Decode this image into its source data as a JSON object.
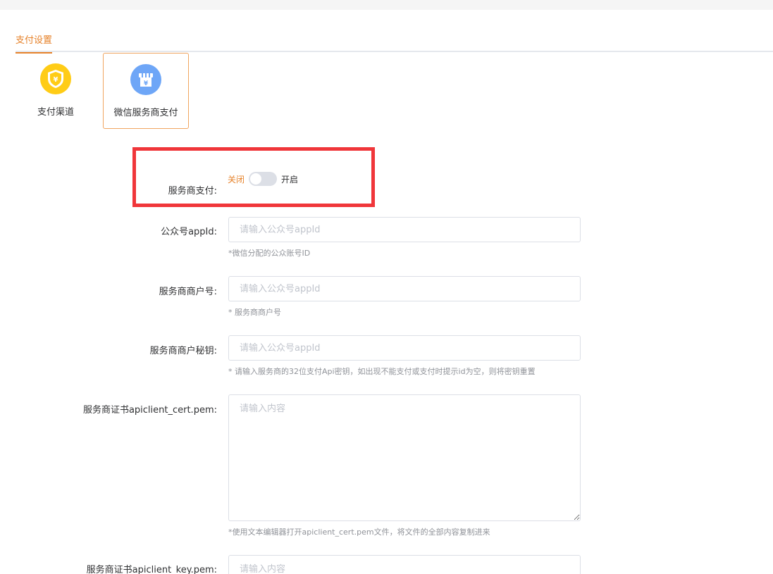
{
  "tabs": {
    "active": "支付设置"
  },
  "channels": [
    {
      "label": "支付渠道",
      "icon": "shield-yuan-icon",
      "color": "#ffcc16"
    },
    {
      "label": "微信服务商支付",
      "icon": "shop-yuan-icon",
      "color": "#6ea6f7",
      "selected": true
    }
  ],
  "form": {
    "service_pay": {
      "label": "服务商支付:",
      "off": "关闭",
      "on": "开启",
      "value": false
    },
    "appid": {
      "label": "公众号appId:",
      "placeholder": "请输入公众号appId",
      "hint": "*微信分配的公众账号ID"
    },
    "mch_id": {
      "label": "服务商商户号:",
      "placeholder": "请输入公众号appId",
      "hint": "* 服务商商户号"
    },
    "mch_key": {
      "label": "服务商商户秘钥:",
      "placeholder": "请输入公众号appId",
      "hint": "* 请输入服务商的32位支付Api密钥，如出现不能支付或支付时提示id为空，则将密钥重置"
    },
    "cert": {
      "label": "服务商证书apiclient_cert.pem:",
      "placeholder": "请输入内容",
      "hint": "*使用文本编辑器打开apiclient_cert.pem文件，将文件的全部内容复制进来"
    },
    "key": {
      "label": "服务商证书apiclient_key.pem:",
      "placeholder": "请输入内容"
    }
  },
  "colors": {
    "accent": "#e6822a",
    "highlight": "#f0363a"
  }
}
